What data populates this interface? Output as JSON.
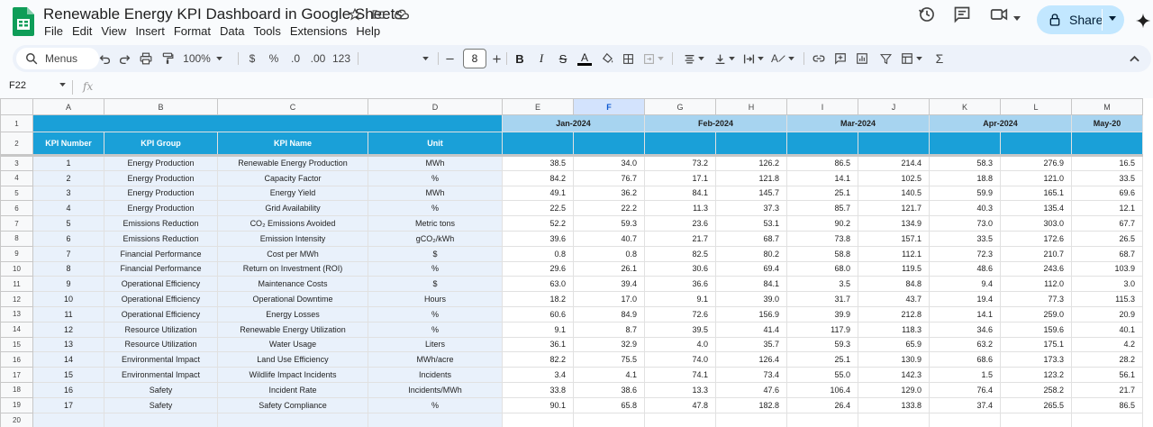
{
  "doc": {
    "title": "Renewable Energy KPI Dashboard in Google Sheets"
  },
  "menu": [
    "File",
    "Edit",
    "View",
    "Insert",
    "Format",
    "Data",
    "Tools",
    "Extensions",
    "Help"
  ],
  "share": {
    "label": "Share"
  },
  "toolbar": {
    "menus_label": "Menus",
    "zoom": "100%",
    "currency": "$",
    "percent": "%",
    "dec_decrease": ".0",
    "dec_increase": ".00",
    "number_format": "123",
    "font_size": "8"
  },
  "formula_bar": {
    "cell_ref": "F22",
    "fx": "fx"
  },
  "grid": {
    "columns": [
      "A",
      "B",
      "C",
      "D",
      "E",
      "F",
      "G",
      "H",
      "I",
      "J",
      "K",
      "L",
      "M"
    ],
    "selected_column": "F",
    "row_numbers": [
      "1",
      "2",
      "3",
      "4",
      "5",
      "6",
      "7",
      "8",
      "9",
      "10",
      "11",
      "12",
      "13",
      "14",
      "15",
      "16",
      "17",
      "18",
      "19",
      "20"
    ],
    "months": [
      "Jan-2024",
      "Feb-2024",
      "Mar-2024",
      "Apr-2024",
      "May-20"
    ],
    "headers": [
      "KPI Number",
      "KPI Group",
      "KPI Name",
      "Unit"
    ],
    "rows": [
      [
        "1",
        "Energy Production",
        "Renewable Energy Production",
        "MWh",
        "38.5",
        "34.0",
        "73.2",
        "126.2",
        "86.5",
        "214.4",
        "58.3",
        "276.9",
        "16.5"
      ],
      [
        "2",
        "Energy Production",
        "Capacity Factor",
        "%",
        "84.2",
        "76.7",
        "17.1",
        "121.8",
        "14.1",
        "102.5",
        "18.8",
        "121.0",
        "33.5"
      ],
      [
        "3",
        "Energy Production",
        "Energy Yield",
        "MWh",
        "49.1",
        "36.2",
        "84.1",
        "145.7",
        "25.1",
        "140.5",
        "59.9",
        "165.1",
        "69.6"
      ],
      [
        "4",
        "Energy Production",
        "Grid Availability",
        "%",
        "22.5",
        "22.2",
        "11.3",
        "37.3",
        "85.7",
        "121.7",
        "40.3",
        "135.4",
        "12.1"
      ],
      [
        "5",
        "Emissions Reduction",
        "CO₂ Emissions Avoided",
        "Metric tons",
        "52.2",
        "59.3",
        "23.6",
        "53.1",
        "90.2",
        "134.9",
        "73.0",
        "303.0",
        "67.7"
      ],
      [
        "6",
        "Emissions Reduction",
        "Emission Intensity",
        "gCO₂/kWh",
        "39.6",
        "40.7",
        "21.7",
        "68.7",
        "73.8",
        "157.1",
        "33.5",
        "172.6",
        "26.5"
      ],
      [
        "7",
        "Financial Performance",
        "Cost per MWh",
        "$",
        "0.8",
        "0.8",
        "82.5",
        "80.2",
        "58.8",
        "112.1",
        "72.3",
        "210.7",
        "68.7"
      ],
      [
        "8",
        "Financial Performance",
        "Return on Investment (ROI)",
        "%",
        "29.6",
        "26.1",
        "30.6",
        "69.4",
        "68.0",
        "119.5",
        "48.6",
        "243.6",
        "103.9"
      ],
      [
        "9",
        "Operational Efficiency",
        "Maintenance Costs",
        "$",
        "63.0",
        "39.4",
        "36.6",
        "84.1",
        "3.5",
        "84.8",
        "9.4",
        "112.0",
        "3.0"
      ],
      [
        "10",
        "Operational Efficiency",
        "Operational Downtime",
        "Hours",
        "18.2",
        "17.0",
        "9.1",
        "39.0",
        "31.7",
        "43.7",
        "19.4",
        "77.3",
        "115.3"
      ],
      [
        "11",
        "Operational Efficiency",
        "Energy Losses",
        "%",
        "60.6",
        "84.9",
        "72.6",
        "156.9",
        "39.9",
        "212.8",
        "14.1",
        "259.0",
        "20.9"
      ],
      [
        "12",
        "Resource Utilization",
        "Renewable Energy Utilization",
        "%",
        "9.1",
        "8.7",
        "39.5",
        "41.4",
        "117.9",
        "118.3",
        "34.6",
        "159.6",
        "40.1"
      ],
      [
        "13",
        "Resource Utilization",
        "Water Usage",
        "Liters",
        "36.1",
        "32.9",
        "4.0",
        "35.7",
        "59.3",
        "65.9",
        "63.2",
        "175.1",
        "4.2"
      ],
      [
        "14",
        "Environmental Impact",
        "Land Use Efficiency",
        "MWh/acre",
        "82.2",
        "75.5",
        "74.0",
        "126.4",
        "25.1",
        "130.9",
        "68.6",
        "173.3",
        "28.2"
      ],
      [
        "15",
        "Environmental Impact",
        "Wildlife Impact Incidents",
        "Incidents",
        "3.4",
        "4.1",
        "74.1",
        "73.4",
        "55.0",
        "142.3",
        "1.5",
        "123.2",
        "56.1"
      ],
      [
        "16",
        "Safety",
        "Incident Rate",
        "Incidents/MWh",
        "33.8",
        "38.6",
        "13.3",
        "47.6",
        "106.4",
        "129.0",
        "76.4",
        "258.2",
        "21.7"
      ],
      [
        "17",
        "Safety",
        "Safety Compliance",
        "%",
        "90.1",
        "65.8",
        "47.8",
        "182.8",
        "26.4",
        "133.8",
        "37.4",
        "265.5",
        "86.5"
      ]
    ]
  },
  "colors": {
    "header_blue": "#1aa0d8",
    "month_header": "#a7d4f0",
    "kpi_cell_bg": "#e9f1fb",
    "share_bg": "#c2e7ff",
    "sheets_green": "#0f9d58"
  }
}
